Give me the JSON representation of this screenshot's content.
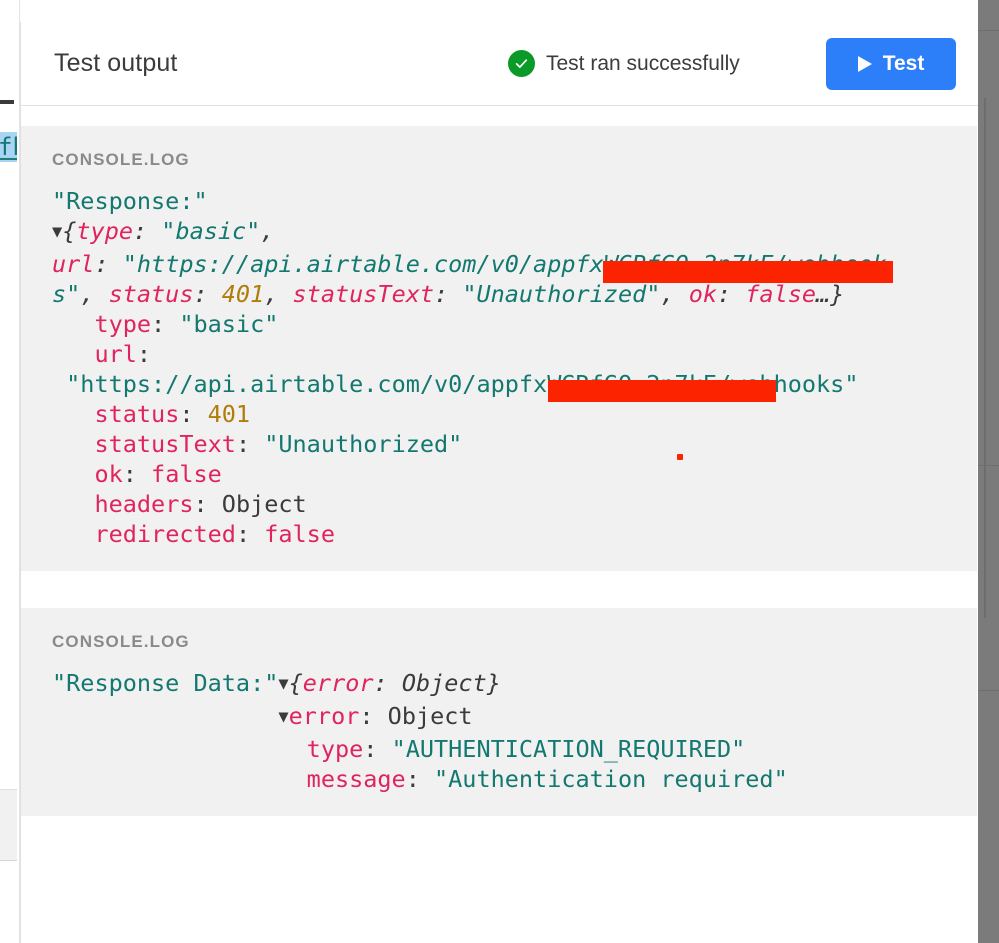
{
  "panel": {
    "title": "Test output",
    "status_text": "Test ran successfully",
    "status_icon": "check-circle-icon",
    "status_color": "#0a9a27",
    "run_button_label": "Test",
    "run_button_icon": "play-icon",
    "accent_color": "#2d7ff9"
  },
  "background": {
    "selected_token": "fb",
    "selection_color": "#aad4f5"
  },
  "console_blocks": [
    {
      "label": "CONSOLE.LOG",
      "lines": [
        {
          "id": "l1",
          "text": "\"Response:\""
        },
        {
          "id": "l2",
          "text": "▼{type: \"basic\", url: \"https://api.airtable.com/v0/appfxWGRfGQ_2n7kE/webhooks\", status: 401, statusText: \"Unauthorized\", ok: false…}"
        },
        {
          "id": "l3",
          "text": "  type: \"basic\""
        },
        {
          "id": "l4",
          "text": "  url: \"https://api.airtable.com/v0/appfxWGRfGQ_2n7kE/webhooks\""
        },
        {
          "id": "l5",
          "text": "  status: 401"
        },
        {
          "id": "l6",
          "text": "  statusText: \"Unauthorized\""
        },
        {
          "id": "l7",
          "text": "  ok: false"
        },
        {
          "id": "l8",
          "text": "  headers: Object"
        },
        {
          "id": "l9",
          "text": "  redirected: false"
        }
      ],
      "redacted": true,
      "redaction_color": "#fc2400"
    },
    {
      "label": "CONSOLE.LOG",
      "lines": [
        {
          "id": "m1",
          "text": "\"Response Data:\"▼{error: Object}"
        },
        {
          "id": "m2",
          "text": "▼error: Object"
        },
        {
          "id": "m3",
          "text": "type: \"AUTHENTICATION_REQUIRED\""
        },
        {
          "id": "m4",
          "text": "message: \"Authentication required\""
        }
      ],
      "redacted": false
    }
  ],
  "log1": {
    "header": "\"Response:\"",
    "collapsed_triangle": "▼",
    "collapsed_open": "{",
    "k_type": "type",
    "v_type": "\"basic\"",
    "k_url": "url",
    "v_url_pre": "\"https://api.airtable.com/v0/app",
    "v_url_redacted": "fxWGRfGQ_2n7kE",
    "v_url_post": "/webhook",
    "v_url_wrap": "s\"",
    "k_status": "status",
    "v_status": "401",
    "k_statusText": "statusText",
    "v_statusText": "\"Unauthorized\"",
    "k_ok": "ok",
    "v_ok": "false",
    "ellipsis_close": "…}",
    "k_headers": "headers",
    "v_headers": "Object",
    "k_redirected": "redirected",
    "v_redirected": "false",
    "url_line_value": "\"https://api.airtable.com/v0/app",
    "url_line_post": "/webhooks\""
  },
  "log2": {
    "header": "\"Response Data:\"",
    "triangle": "▼",
    "obj_brace": "{",
    "k_error_inline": "error",
    "v_error_inline": "Object",
    "obj_brace_close": "}",
    "k_error": "error",
    "v_error": "Object",
    "k_type": "type",
    "v_type": "\"AUTHENTICATION_REQUIRED\"",
    "k_message": "message",
    "v_message": "\"Authentication required\""
  }
}
